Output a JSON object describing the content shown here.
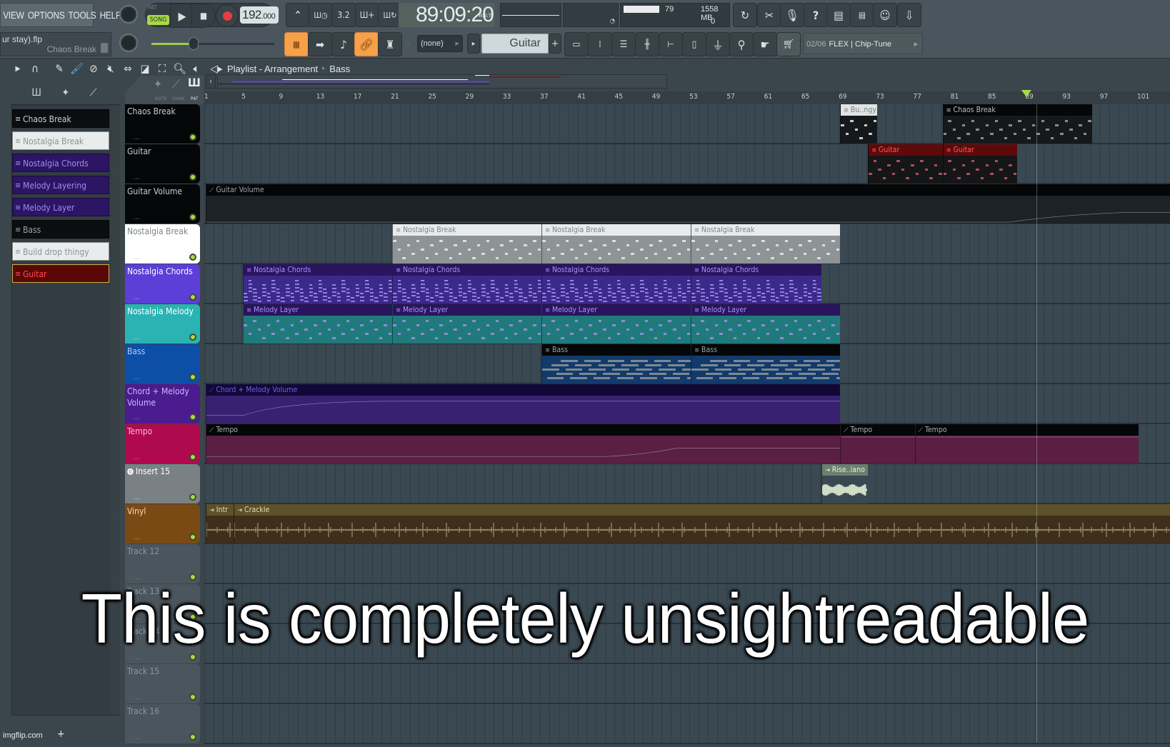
{
  "menu": [
    "VIEW",
    "OPTIONS",
    "TOOLS",
    "HELP"
  ],
  "file": {
    "name": "ur stay).flp",
    "pattern": "Chaos Break"
  },
  "transport": {
    "pat_label": "PAT",
    "song_label": "SONG",
    "mode": "SONG",
    "tempo_int": "192",
    "tempo_dec": ".000"
  },
  "clock": {
    "time": "89:09:20",
    "format": "B:S:T"
  },
  "cpu": {
    "cpu": "79",
    "memory": "1558 MB",
    "polyphony": "0"
  },
  "master_volume": 0.5,
  "snap": "(none)",
  "channel": "Guitar",
  "hint_bar": {
    "counter": "02/06",
    "text": "FLEX | Chip-Tune"
  },
  "toolbar_icons": [
    "metronome-icon",
    "wait-input-icon",
    "countdown-icon",
    "step-edit-icon",
    "loop-record-icon"
  ],
  "toolbar2_icons": [
    "playlist-icon",
    "arrow-icon",
    "note-icon",
    "link-icon",
    "touch-icon"
  ],
  "view_icons": [
    "piano-roll-icon",
    "channel-rack-icon",
    "mixer-icon",
    "browser-icon",
    "plugin-icon",
    "playlist-icon",
    "plugin-db-icon",
    "pedal-icon",
    "hand-icon",
    "cart-icon"
  ],
  "right_icons": [
    "undo-icon",
    "cut-icon",
    "record-audio-icon",
    "help-icon",
    "save-icon",
    "export-icon",
    "chat-icon",
    "download-icon"
  ],
  "playlist": {
    "title": "Playlist - Arrangement",
    "breadcrumb": "Bass",
    "filter_tabs": {
      "note": "NOTE",
      "chan": "CHAN",
      "pat": "PAT"
    }
  },
  "patterns": [
    {
      "name": "Chaos Break",
      "bg": "#0b0d0e",
      "fg": "#c8d0d4"
    },
    {
      "name": "Nostalgia Break",
      "bg": "#e9ecec",
      "fg": "#8d9497"
    },
    {
      "name": "Nostalgia Chords",
      "bg": "#2c1563",
      "fg": "#9e8cf2"
    },
    {
      "name": "Melody Layering",
      "bg": "#2c1563",
      "fg": "#9e8cf2"
    },
    {
      "name": "Melody Layer",
      "bg": "#2c1563",
      "fg": "#9e8cf2"
    },
    {
      "name": "Bass",
      "bg": "#0b0d0e",
      "fg": "#9aa3a7"
    },
    {
      "name": "Build drop thingy",
      "bg": "#e9ecec",
      "fg": "#8d9497"
    },
    {
      "name": "Guitar",
      "bg": "#5a0707",
      "fg": "#ff4b52",
      "selected": true
    }
  ],
  "ruler": {
    "ticks": [
      "1",
      "5",
      "9",
      "13",
      "17",
      "21",
      "25",
      "29",
      "33",
      "37",
      "41",
      "45",
      "49",
      "53",
      "57",
      "61",
      "65",
      "69",
      "73",
      "77",
      "81",
      "85",
      "89",
      "93",
      "97",
      "101"
    ],
    "playhead_bar": 89
  },
  "tracks": [
    {
      "name": "Chaos Break",
      "bg": "#050607",
      "fg": "#c7cfd3"
    },
    {
      "name": "Guitar",
      "bg": "#050607",
      "fg": "#c7cfd3"
    },
    {
      "name": "Guitar Volume",
      "bg": "#050607",
      "fg": "#c7cfd3"
    },
    {
      "name": "Nostalgia Break",
      "bg": "#ffffff",
      "fg": "#7b8488"
    },
    {
      "name": "Nostalgia Chords",
      "bg": "#5b3fd6",
      "fg": "#ffffff"
    },
    {
      "name": "Nostalgia Melody",
      "bg": "#2bb3b3",
      "fg": "#ffffff"
    },
    {
      "name": "Bass",
      "bg": "#0d4ea6",
      "fg": "#b3ccff"
    },
    {
      "name": "Chord + Melody Volume",
      "bg": "#4a1c8f",
      "fg": "#cdb8ff"
    },
    {
      "name": "Tempo",
      "bg": "#b00a4e",
      "fg": "#ffb3d3"
    },
    {
      "name": "Insert 15",
      "bg": "#7a8185",
      "fg": "#ffffff",
      "icon": "audio-input-icon"
    },
    {
      "name": "Vinyl",
      "bg": "#7a4a14",
      "fg": "#ffdca8"
    },
    {
      "name": "Track 12",
      "bg": "#4b555d",
      "fg": "#8c979c"
    },
    {
      "name": "Track 13",
      "bg": "#4b555d",
      "fg": "#8c979c"
    },
    {
      "name": "Track 14",
      "bg": "#4b555d",
      "fg": "#8c979c"
    },
    {
      "name": "Track 15",
      "bg": "#4b555d",
      "fg": "#8c979c"
    },
    {
      "name": "Track 16",
      "bg": "#4b555d",
      "fg": "#8c979c"
    }
  ],
  "clips": [
    {
      "track": 0,
      "label": "Bu..ngy",
      "start": 69,
      "end": 73,
      "type": "pattern",
      "head": "#dfe3e4",
      "headfg": "#7c8589",
      "body": "#15191b"
    },
    {
      "track": 0,
      "label": "Chaos Break",
      "start": 80,
      "end": 96,
      "type": "pattern",
      "head": "#060708",
      "headfg": "#b8c0c4",
      "body": "#15191b"
    },
    {
      "track": 1,
      "label": "Guitar",
      "start": 72,
      "end": 80,
      "type": "pattern",
      "head": "#5e0a0a",
      "headfg": "#ff5a60",
      "body": "#141617"
    },
    {
      "track": 1,
      "label": "Guitar",
      "start": 80,
      "end": 88,
      "type": "pattern",
      "head": "#5e0a0a",
      "headfg": "#ff5a60",
      "body": "#141617"
    },
    {
      "track": 2,
      "label": "Guitar Volume",
      "start": 1,
      "end": 106,
      "type": "automation",
      "head": "#050607",
      "headfg": "#9aa3a7",
      "body": "#1c2226"
    },
    {
      "track": 3,
      "label": "Nostalgia Break",
      "start": 21,
      "end": 37,
      "type": "pattern",
      "head": "#e8ebec",
      "headfg": "#7c8589",
      "body": "#8e9396"
    },
    {
      "track": 3,
      "label": "Nostalgia Break",
      "start": 37,
      "end": 53,
      "type": "pattern",
      "head": "#e8ebec",
      "headfg": "#7c8589",
      "body": "#8e9396"
    },
    {
      "track": 3,
      "label": "Nostalgia Break",
      "start": 53,
      "end": 69,
      "type": "pattern",
      "head": "#e8ebec",
      "headfg": "#7c8589",
      "body": "#8e9396"
    },
    {
      "track": 4,
      "label": "Nostalgia Chords",
      "start": 5,
      "end": 21,
      "type": "pattern",
      "head": "#2a145e",
      "headfg": "#a794ff",
      "body": "#3c2a8a"
    },
    {
      "track": 4,
      "label": "Nostalgia Chords",
      "start": 21,
      "end": 37,
      "type": "pattern",
      "head": "#2a145e",
      "headfg": "#a794ff",
      "body": "#3c2a8a"
    },
    {
      "track": 4,
      "label": "Nostalgia Chords",
      "start": 37,
      "end": 53,
      "type": "pattern",
      "head": "#2a145e",
      "headfg": "#a794ff",
      "body": "#3c2a8a"
    },
    {
      "track": 4,
      "label": "Nostalgia Chords",
      "start": 53,
      "end": 67,
      "type": "pattern",
      "head": "#2a145e",
      "headfg": "#a794ff",
      "body": "#3c2a8a"
    },
    {
      "track": 5,
      "label": "Melody Layer",
      "start": 5,
      "end": 21,
      "type": "pattern",
      "head": "#2a145e",
      "headfg": "#a794ff",
      "body": "#207a7c"
    },
    {
      "track": 5,
      "label": "Melody Layer",
      "start": 21,
      "end": 37,
      "type": "pattern",
      "head": "#2a145e",
      "headfg": "#a794ff",
      "body": "#207a7c"
    },
    {
      "track": 5,
      "label": "Melody Layer",
      "start": 37,
      "end": 53,
      "type": "pattern",
      "head": "#2a145e",
      "headfg": "#a794ff",
      "body": "#207a7c"
    },
    {
      "track": 5,
      "label": "Melody Layer",
      "start": 53,
      "end": 69,
      "type": "pattern",
      "head": "#2a145e",
      "headfg": "#a794ff",
      "body": "#207a7c"
    },
    {
      "track": 6,
      "label": "Bass",
      "start": 37,
      "end": 53,
      "type": "pattern",
      "head": "#050607",
      "headfg": "#9aa3a7",
      "body": "#123a6b"
    },
    {
      "track": 6,
      "label": "Bass",
      "start": 53,
      "end": 69,
      "type": "pattern",
      "head": "#050607",
      "headfg": "#9aa3a7",
      "body": "#123a6b"
    },
    {
      "track": 7,
      "label": "Chord + Melody Volume",
      "start": 1,
      "end": 69,
      "type": "automation",
      "head": "#110838",
      "headfg": "#7b5cf0",
      "body": "#372170"
    },
    {
      "track": 8,
      "label": "Tempo",
      "start": 1,
      "end": 69,
      "type": "automation",
      "head": "#050607",
      "headfg": "#a9b0b3",
      "body": "#5a1f42"
    },
    {
      "track": 8,
      "label": "Tempo",
      "start": 69,
      "end": 77,
      "type": "automation",
      "head": "#050607",
      "headfg": "#a9b0b3",
      "body": "#5a1f42"
    },
    {
      "track": 8,
      "label": "Tempo",
      "start": 77,
      "end": 101,
      "type": "automation",
      "head": "#050607",
      "headfg": "#a9b0b3",
      "body": "#5a1f42"
    },
    {
      "track": 9,
      "label": "Rise..iano",
      "start": 67,
      "end": 72,
      "type": "audio",
      "head": "#6c7f6d",
      "headfg": "#e6f0e4",
      "body": "#3a4851"
    },
    {
      "track": 10,
      "label": "Intr",
      "start": 1,
      "end": 4,
      "type": "audio",
      "head": "#5d5128",
      "headfg": "#e8dcb0",
      "body": "#3e2f1c"
    },
    {
      "track": 10,
      "label": "Crackle",
      "start": 4,
      "end": 106,
      "type": "audio",
      "head": "#5d5128",
      "headfg": "#e8dcb0",
      "body": "#3e2f1c"
    }
  ],
  "caption": "This is completely unsightreadable",
  "watermark": "imgflip.com",
  "colors": {
    "accent_green": "#a8d94c",
    "accent_orange": "#f6a04a",
    "panel": "#4b555d"
  }
}
